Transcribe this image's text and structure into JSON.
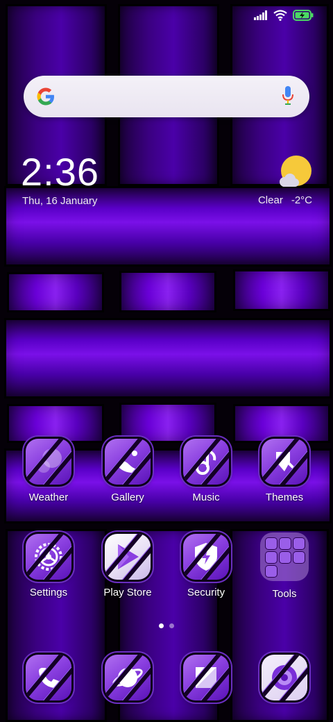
{
  "status_bar": {
    "signal_icon": "signal-icon",
    "wifi_icon": "wifi-icon",
    "battery_icon": "battery-charging-icon",
    "battery_color": "#4cd964"
  },
  "search": {
    "logo_icon": "google-logo-icon",
    "mic_icon": "mic-icon"
  },
  "clock": {
    "time": "2:36",
    "date": "Thu, 16 January"
  },
  "weather": {
    "condition": "Clear",
    "temperature": "-2°C",
    "icon": "sun-cloud-icon"
  },
  "apps_row1": [
    {
      "label": "Weather",
      "icon": "weather-icon"
    },
    {
      "label": "Gallery",
      "icon": "gallery-icon"
    },
    {
      "label": "Music",
      "icon": "music-icon"
    },
    {
      "label": "Themes",
      "icon": "themes-icon"
    }
  ],
  "apps_row2": [
    {
      "label": "Settings",
      "icon": "settings-icon"
    },
    {
      "label": "Play Store",
      "icon": "play-store-icon"
    },
    {
      "label": "Security",
      "icon": "security-icon"
    },
    {
      "label": "Tools",
      "icon": "folder-icon"
    }
  ],
  "dock": [
    {
      "icon": "phone-icon"
    },
    {
      "icon": "browser-icon"
    },
    {
      "icon": "messages-icon"
    },
    {
      "icon": "camera-icon"
    }
  ],
  "page_indicator": {
    "pages": 2,
    "current": 1
  },
  "colors": {
    "accent": "#8a3fe0",
    "wallpaper": "#4a00a8"
  }
}
